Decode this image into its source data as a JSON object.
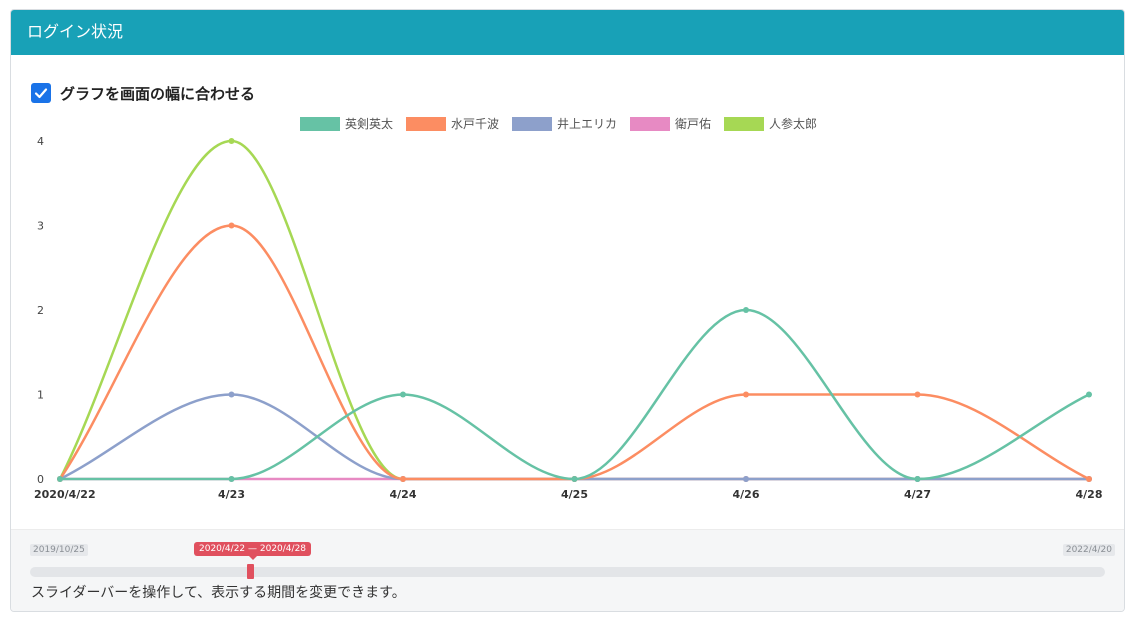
{
  "card": {
    "title": "ログイン状況"
  },
  "fit_option": {
    "label": "グラフを画面の幅に合わせる",
    "checked": true
  },
  "chart_data": {
    "type": "line",
    "categories": [
      "2020/4/22",
      "4/23",
      "4/24",
      "4/25",
      "4/26",
      "4/27",
      "4/28"
    ],
    "ylim": [
      0,
      4
    ],
    "yticks": [
      0,
      1,
      2,
      3,
      4
    ],
    "legend_position": "top-center",
    "series": [
      {
        "name": "英剣英太",
        "color": "#66c2a5",
        "values": [
          0,
          0,
          1,
          0,
          2,
          0,
          1
        ]
      },
      {
        "name": "水戸千波",
        "color": "#fc8d62",
        "values": [
          0,
          3,
          0,
          0,
          1,
          1,
          0
        ]
      },
      {
        "name": "井上エリカ",
        "color": "#8da0cb",
        "values": [
          0,
          1,
          0,
          0,
          0,
          0,
          0
        ]
      },
      {
        "name": "衛戸佑",
        "color": "#e78ac3",
        "values": [
          0,
          0,
          0,
          0,
          0,
          0,
          0
        ]
      },
      {
        "name": "人参太郎",
        "color": "#a6d854",
        "values": [
          0,
          4,
          0,
          0,
          0,
          0,
          0
        ]
      }
    ]
  },
  "range_slider": {
    "min_label": "2019/10/25",
    "max_label": "2022/4/20",
    "selected_label": "2020/4/22 — 2020/4/28",
    "help_text": "スライダーバーを操作して、表示する期間を変更できます。"
  }
}
